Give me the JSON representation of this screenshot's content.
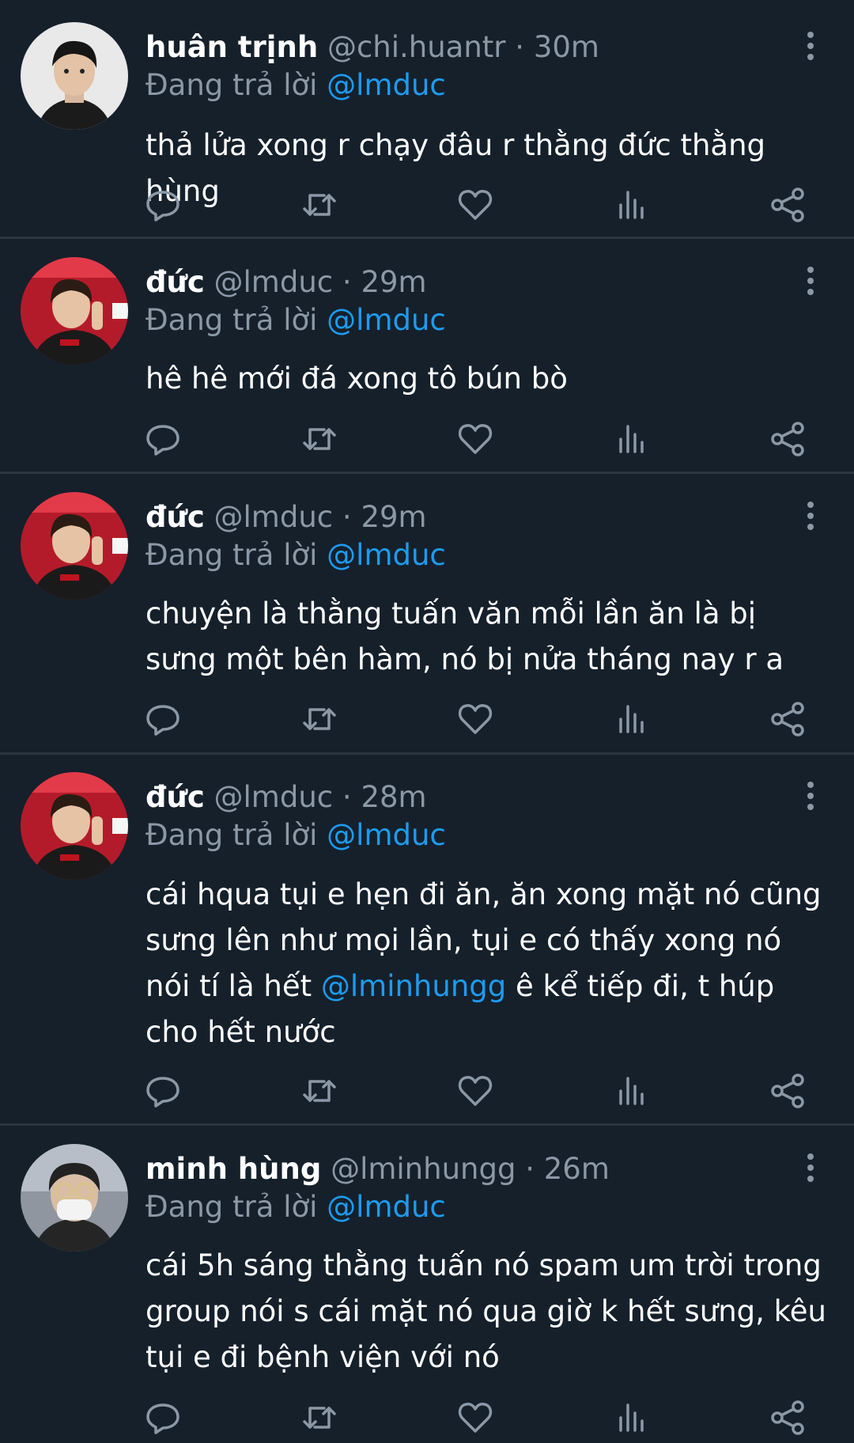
{
  "tweets": [
    {
      "name": "huân trịnh",
      "handle": "@chi.huantr",
      "separator": "·",
      "time": "30m",
      "reply_prefix": "Đang trả lời",
      "reply_to": "@lmduc",
      "text_parts": [
        "thả lửa xong r chạy đâu r thằng đức thằng hùng"
      ]
    },
    {
      "name": "đức",
      "handle": "@lmduc",
      "separator": "·",
      "time": "29m",
      "reply_prefix": "Đang trả lời",
      "reply_to": "@lmduc",
      "text_parts": [
        "hê hê mới đá xong tô bún bò"
      ]
    },
    {
      "name": "đức",
      "handle": "@lmduc",
      "separator": "·",
      "time": "29m",
      "reply_prefix": "Đang trả lời",
      "reply_to": "@lmduc",
      "text_parts": [
        "chuyện là thằng tuấn văn mỗi lần ăn là bị sưng một bên hàm, nó bị nửa tháng nay r a"
      ]
    },
    {
      "name": "đức",
      "handle": "@lmduc",
      "separator": "·",
      "time": "28m",
      "reply_prefix": "Đang trả lời",
      "reply_to": "@lmduc",
      "text_parts": [
        "cái hqua tụi e hẹn đi ăn, ăn xong mặt nó cũng sưng lên như mọi lần, tụi e có thấy xong nó nói tí là hết ",
        "@lminhungg",
        " ê kể tiếp đi, t húp cho hết nước"
      ]
    },
    {
      "name": "minh hùng",
      "handle": "@lminhungg",
      "separator": "·",
      "time": "26m",
      "reply_prefix": "Đang trả lời",
      "reply_to": "@lmduc",
      "text_parts": [
        "cái 5h sáng thằng tuấn nó spam um trời trong group nói s cái mặt nó qua giờ k hết sưng, kêu tụi e đi bệnh viện với nó"
      ]
    }
  ],
  "icons": {
    "more": "more-vertical-icon",
    "reply": "reply-bubble-icon",
    "retweet": "retweet-icon",
    "like": "heart-icon",
    "views": "bar-chart-icon",
    "share": "share-icon"
  },
  "colors": {
    "background": "#15202b",
    "text": "#ffffff",
    "muted": "#8b98a5",
    "mention": "#1d9bf0",
    "divider": "#2a3541"
  }
}
